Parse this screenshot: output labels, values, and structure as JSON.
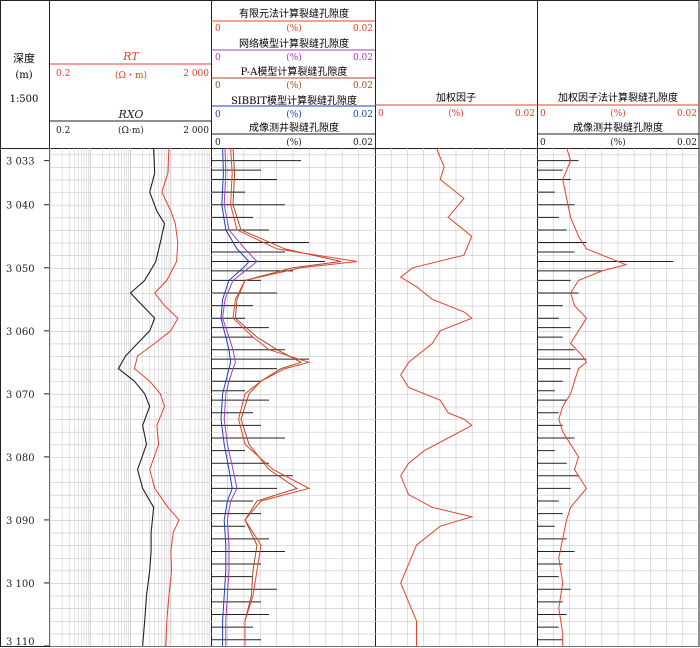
{
  "colors": {
    "red": "#e8412f",
    "black": "#222222",
    "purple": "#9b3fc0",
    "blue": "#1f3fb0",
    "brown": "#a05028",
    "grid": "#c8c8c8"
  },
  "depth_track": {
    "label": "深度",
    "unit": "(m)",
    "scale": "1:500",
    "ticks": [
      "3 033",
      "3 040",
      "3 050",
      "3 060",
      "3 070",
      "3 080",
      "3 090",
      "3 100",
      "3 110"
    ]
  },
  "resistivity_track": {
    "rt": {
      "name": "RT",
      "unit": "(Ω・m)",
      "min": "0.2",
      "max": "2 000"
    },
    "rxo": {
      "name": "RXO",
      "unit": "(Ω·m)",
      "min": "0.2",
      "max": "2 000"
    }
  },
  "porosity_track": {
    "curves": [
      {
        "name": "有限元法计算裂缝孔隙度",
        "unit": "(%)",
        "min": "0",
        "max": "0.02"
      },
      {
        "name": "网络模型计算裂缝孔隙度",
        "unit": "(%)",
        "min": "0",
        "max": "0.02"
      },
      {
        "name": "P-A模型计算裂缝孔隙度",
        "unit": "(%)",
        "min": "0",
        "max": "0.02"
      },
      {
        "name": "SIBBIT模型计算裂缝孔隙度",
        "unit": "(%)",
        "min": "0",
        "max": "0.02"
      },
      {
        "name": "成像测井裂缝孔隙度",
        "unit": "(%)",
        "min": "0",
        "max": "0.02"
      }
    ]
  },
  "weight_track": {
    "name": "加权因子",
    "unit": "(%)",
    "min": "0",
    "max": "0.02"
  },
  "weighted_track": {
    "curves": [
      {
        "name": "加权因子法计算裂缝孔隙度",
        "unit": "(%)",
        "min": "0",
        "max": "0.02"
      },
      {
        "name": "成像测井裂缝孔隙度",
        "unit": "(%)",
        "min": "0",
        "max": "0.02"
      }
    ]
  },
  "chart_data": {
    "type": "line",
    "y_axis": "depth_m",
    "ylim": [
      3031,
      3110
    ],
    "rt_points": [
      [
        3031,
        180
      ],
      [
        3035,
        170
      ],
      [
        3038,
        120
      ],
      [
        3041,
        200
      ],
      [
        3043,
        260
      ],
      [
        3046,
        300
      ],
      [
        3049,
        280
      ],
      [
        3052,
        160
      ],
      [
        3054,
        80
      ],
      [
        3056,
        140
      ],
      [
        3058,
        300
      ],
      [
        3060,
        200
      ],
      [
        3062,
        80
      ],
      [
        3064,
        30
      ],
      [
        3066,
        25
      ],
      [
        3068,
        60
      ],
      [
        3070,
        110
      ],
      [
        3072,
        140
      ],
      [
        3075,
        90
      ],
      [
        3078,
        100
      ],
      [
        3082,
        60
      ],
      [
        3085,
        80
      ],
      [
        3088,
        170
      ],
      [
        3090,
        320
      ],
      [
        3092,
        230
      ],
      [
        3095,
        200
      ],
      [
        3098,
        210
      ],
      [
        3102,
        180
      ],
      [
        3106,
        160
      ],
      [
        3110,
        150
      ]
    ],
    "rxo_points": [
      [
        3031,
        75
      ],
      [
        3035,
        80
      ],
      [
        3038,
        60
      ],
      [
        3041,
        90
      ],
      [
        3043,
        140
      ],
      [
        3046,
        110
      ],
      [
        3049,
        85
      ],
      [
        3052,
        45
      ],
      [
        3054,
        20
      ],
      [
        3056,
        40
      ],
      [
        3058,
        80
      ],
      [
        3060,
        60
      ],
      [
        3062,
        30
      ],
      [
        3064,
        15
      ],
      [
        3066,
        10
      ],
      [
        3068,
        25
      ],
      [
        3070,
        45
      ],
      [
        3072,
        60
      ],
      [
        3075,
        40
      ],
      [
        3078,
        50
      ],
      [
        3082,
        30
      ],
      [
        3085,
        40
      ],
      [
        3088,
        75
      ],
      [
        3090,
        70
      ],
      [
        3092,
        65
      ],
      [
        3095,
        65
      ],
      [
        3098,
        60
      ],
      [
        3102,
        50
      ],
      [
        3106,
        45
      ],
      [
        3110,
        40
      ]
    ],
    "fem_points": [
      [
        3031,
        0.0022
      ],
      [
        3035,
        0.0024
      ],
      [
        3040,
        0.0022
      ],
      [
        3044,
        0.003
      ],
      [
        3047,
        0.008
      ],
      [
        3049,
        0.018
      ],
      [
        3050,
        0.011
      ],
      [
        3052,
        0.004
      ],
      [
        3055,
        0.0028
      ],
      [
        3058,
        0.0025
      ],
      [
        3061,
        0.005
      ],
      [
        3063,
        0.007
      ],
      [
        3065,
        0.012
      ],
      [
        3066,
        0.009
      ],
      [
        3068,
        0.006
      ],
      [
        3070,
        0.004
      ],
      [
        3074,
        0.0032
      ],
      [
        3078,
        0.004
      ],
      [
        3082,
        0.0075
      ],
      [
        3085,
        0.012
      ],
      [
        3087,
        0.006
      ],
      [
        3090,
        0.004
      ],
      [
        3094,
        0.006
      ],
      [
        3098,
        0.0055
      ],
      [
        3102,
        0.005
      ],
      [
        3106,
        0.004
      ],
      [
        3110,
        0.004
      ]
    ],
    "network_points": [
      [
        3031,
        0.0015
      ],
      [
        3035,
        0.0016
      ],
      [
        3040,
        0.0014
      ],
      [
        3044,
        0.002
      ],
      [
        3047,
        0.004
      ],
      [
        3049,
        0.0055
      ],
      [
        3050,
        0.0045
      ],
      [
        3052,
        0.0025
      ],
      [
        3055,
        0.0015
      ],
      [
        3058,
        0.0012
      ],
      [
        3061,
        0.002
      ],
      [
        3063,
        0.0025
      ],
      [
        3065,
        0.0028
      ],
      [
        3066,
        0.0025
      ],
      [
        3068,
        0.002
      ],
      [
        3070,
        0.0016
      ],
      [
        3074,
        0.0014
      ],
      [
        3078,
        0.0018
      ],
      [
        3082,
        0.0025
      ],
      [
        3085,
        0.003
      ],
      [
        3087,
        0.0022
      ],
      [
        3090,
        0.0018
      ],
      [
        3094,
        0.002
      ],
      [
        3098,
        0.002
      ],
      [
        3102,
        0.0018
      ],
      [
        3106,
        0.0016
      ],
      [
        3110,
        0.0016
      ]
    ],
    "pa_points": [
      [
        3031,
        0.0025
      ],
      [
        3035,
        0.0027
      ],
      [
        3040,
        0.0025
      ],
      [
        3044,
        0.0035
      ],
      [
        3047,
        0.009
      ],
      [
        3049,
        0.016
      ],
      [
        3050,
        0.01
      ],
      [
        3052,
        0.004
      ],
      [
        3055,
        0.003
      ],
      [
        3058,
        0.0028
      ],
      [
        3061,
        0.0055
      ],
      [
        3063,
        0.008
      ],
      [
        3065,
        0.011
      ],
      [
        3066,
        0.0085
      ],
      [
        3068,
        0.006
      ],
      [
        3070,
        0.0045
      ],
      [
        3074,
        0.0035
      ],
      [
        3078,
        0.0045
      ],
      [
        3082,
        0.007
      ],
      [
        3085,
        0.0105
      ],
      [
        3087,
        0.0055
      ],
      [
        3090,
        0.004
      ],
      [
        3094,
        0.0055
      ],
      [
        3098,
        0.005
      ],
      [
        3102,
        0.0048
      ],
      [
        3106,
        0.004
      ],
      [
        3110,
        0.004
      ]
    ],
    "sibbit_points": [
      [
        3031,
        0.0012
      ],
      [
        3035,
        0.0013
      ],
      [
        3040,
        0.0011
      ],
      [
        3044,
        0.0016
      ],
      [
        3047,
        0.003
      ],
      [
        3049,
        0.0045
      ],
      [
        3050,
        0.0038
      ],
      [
        3052,
        0.002
      ],
      [
        3055,
        0.0012
      ],
      [
        3058,
        0.001
      ],
      [
        3061,
        0.0016
      ],
      [
        3063,
        0.002
      ],
      [
        3065,
        0.0022
      ],
      [
        3066,
        0.002
      ],
      [
        3068,
        0.0016
      ],
      [
        3070,
        0.0012
      ],
      [
        3074,
        0.001
      ],
      [
        3078,
        0.0014
      ],
      [
        3082,
        0.002
      ],
      [
        3085,
        0.0024
      ],
      [
        3087,
        0.0018
      ],
      [
        3090,
        0.0014
      ],
      [
        3094,
        0.0016
      ],
      [
        3098,
        0.0016
      ],
      [
        3102,
        0.0014
      ],
      [
        3106,
        0.0012
      ],
      [
        3110,
        0.0012
      ]
    ],
    "image_bars": [
      [
        3033,
        0.011
      ],
      [
        3034.5,
        0.006
      ],
      [
        3036,
        0.008
      ],
      [
        3038,
        0.004
      ],
      [
        3040,
        0.009
      ],
      [
        3042,
        0.005
      ],
      [
        3044,
        0.007
      ],
      [
        3046,
        0.012
      ],
      [
        3047.5,
        0.009
      ],
      [
        3049,
        0.014
      ],
      [
        3050.5,
        0.01
      ],
      [
        3052,
        0.006
      ],
      [
        3054,
        0.008
      ],
      [
        3056,
        0.005
      ],
      [
        3058,
        0.004
      ],
      [
        3059.5,
        0.007
      ],
      [
        3061,
        0.005
      ],
      [
        3063,
        0.009
      ],
      [
        3064.5,
        0.012
      ],
      [
        3066,
        0.008
      ],
      [
        3068,
        0.006
      ],
      [
        3069.5,
        0.004
      ],
      [
        3071,
        0.007
      ],
      [
        3073,
        0.005
      ],
      [
        3075,
        0.006
      ],
      [
        3077,
        0.009
      ],
      [
        3079,
        0.004
      ],
      [
        3081,
        0.007
      ],
      [
        3083,
        0.01
      ],
      [
        3085,
        0.008
      ],
      [
        3087,
        0.005
      ],
      [
        3089,
        0.006
      ],
      [
        3091,
        0.004
      ],
      [
        3093,
        0.007
      ],
      [
        3095,
        0.009
      ],
      [
        3097,
        0.006
      ],
      [
        3099,
        0.005
      ],
      [
        3101,
        0.008
      ],
      [
        3103,
        0.006
      ],
      [
        3105,
        0.007
      ],
      [
        3107,
        0.005
      ],
      [
        3109,
        0.006
      ]
    ],
    "weight_points": [
      [
        3031,
        0.0075
      ],
      [
        3034,
        0.0085
      ],
      [
        3036,
        0.008
      ],
      [
        3039,
        0.011
      ],
      [
        3042,
        0.009
      ],
      [
        3045,
        0.012
      ],
      [
        3048,
        0.011
      ],
      [
        3050,
        0.0045
      ],
      [
        3051.5,
        0.003
      ],
      [
        3053,
        0.005
      ],
      [
        3055,
        0.007
      ],
      [
        3057,
        0.011
      ],
      [
        3058,
        0.012
      ],
      [
        3060,
        0.008
      ],
      [
        3062,
        0.007
      ],
      [
        3065,
        0.004
      ],
      [
        3067,
        0.003
      ],
      [
        3069,
        0.004
      ],
      [
        3071,
        0.008
      ],
      [
        3073,
        0.009
      ],
      [
        3074,
        0.011
      ],
      [
        3075,
        0.012
      ],
      [
        3077,
        0.009
      ],
      [
        3079,
        0.006
      ],
      [
        3081,
        0.004
      ],
      [
        3083,
        0.003
      ],
      [
        3086,
        0.004
      ],
      [
        3088,
        0.007
      ],
      [
        3089.5,
        0.012
      ],
      [
        3091,
        0.008
      ],
      [
        3094,
        0.005
      ],
      [
        3097,
        0.004
      ],
      [
        3100,
        0.003
      ],
      [
        3103,
        0.004
      ],
      [
        3106,
        0.005
      ],
      [
        3110,
        0.005
      ]
    ],
    "weighted_points": [
      [
        3031,
        0.0035
      ],
      [
        3033,
        0.004
      ],
      [
        3036,
        0.003
      ],
      [
        3039,
        0.0035
      ],
      [
        3042,
        0.004
      ],
      [
        3045,
        0.005
      ],
      [
        3047,
        0.006
      ],
      [
        3048.5,
        0.009
      ],
      [
        3049.5,
        0.011
      ],
      [
        3050.5,
        0.008
      ],
      [
        3052,
        0.005
      ],
      [
        3054,
        0.004
      ],
      [
        3056,
        0.0045
      ],
      [
        3058,
        0.006
      ],
      [
        3060,
        0.005
      ],
      [
        3062,
        0.004
      ],
      [
        3064,
        0.0055
      ],
      [
        3065,
        0.006
      ],
      [
        3066,
        0.005
      ],
      [
        3068,
        0.0045
      ],
      [
        3070,
        0.004
      ],
      [
        3072,
        0.003
      ],
      [
        3074,
        0.0025
      ],
      [
        3076,
        0.003
      ],
      [
        3078,
        0.004
      ],
      [
        3080,
        0.005
      ],
      [
        3082,
        0.0045
      ],
      [
        3085,
        0.006
      ],
      [
        3088,
        0.004
      ],
      [
        3090,
        0.0035
      ],
      [
        3093,
        0.003
      ],
      [
        3096,
        0.0025
      ],
      [
        3100,
        0.003
      ],
      [
        3104,
        0.0025
      ],
      [
        3108,
        0.003
      ],
      [
        3110,
        0.003
      ]
    ],
    "weighted_image_bars": [
      [
        3033,
        0.005
      ],
      [
        3034.5,
        0.003
      ],
      [
        3036,
        0.004
      ],
      [
        3038,
        0.002
      ],
      [
        3040,
        0.0045
      ],
      [
        3042,
        0.0025
      ],
      [
        3044,
        0.0035
      ],
      [
        3046,
        0.006
      ],
      [
        3047.5,
        0.0045
      ],
      [
        3049,
        0.017
      ],
      [
        3050.5,
        0.008
      ],
      [
        3052,
        0.004
      ],
      [
        3054,
        0.005
      ],
      [
        3056,
        0.003
      ],
      [
        3058,
        0.0025
      ],
      [
        3059.5,
        0.004
      ],
      [
        3061,
        0.003
      ],
      [
        3063,
        0.0045
      ],
      [
        3064.5,
        0.006
      ],
      [
        3066,
        0.004
      ],
      [
        3068,
        0.003
      ],
      [
        3069.5,
        0.002
      ],
      [
        3071,
        0.0035
      ],
      [
        3073,
        0.0025
      ],
      [
        3075,
        0.003
      ],
      [
        3077,
        0.0045
      ],
      [
        3079,
        0.002
      ],
      [
        3081,
        0.0035
      ],
      [
        3083,
        0.005
      ],
      [
        3085,
        0.004
      ],
      [
        3087,
        0.0025
      ],
      [
        3089,
        0.003
      ],
      [
        3091,
        0.002
      ],
      [
        3093,
        0.0035
      ],
      [
        3095,
        0.0045
      ],
      [
        3097,
        0.003
      ],
      [
        3099,
        0.0025
      ],
      [
        3101,
        0.004
      ],
      [
        3103,
        0.003
      ],
      [
        3105,
        0.0035
      ],
      [
        3107,
        0.0025
      ],
      [
        3109,
        0.003
      ]
    ]
  }
}
